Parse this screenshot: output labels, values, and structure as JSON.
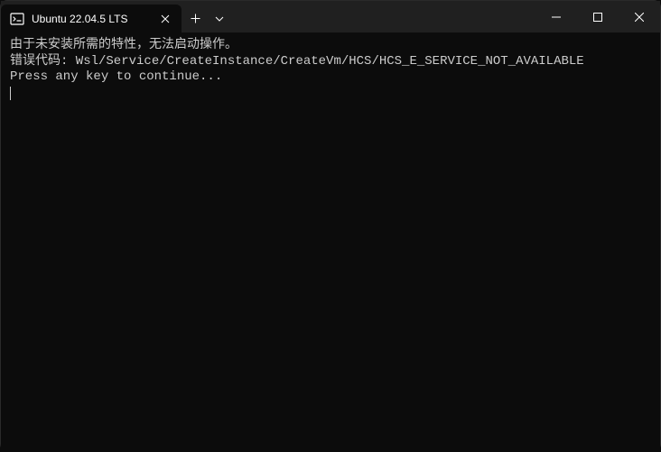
{
  "window": {
    "tab": {
      "title": "Ubuntu 22.04.5 LTS"
    }
  },
  "terminal": {
    "line1": "由于未安装所需的特性，无法启动操作。",
    "line2": "错误代码: Wsl/Service/CreateInstance/CreateVm/HCS/HCS_E_SERVICE_NOT_AVAILABLE",
    "line3": "Press any key to continue..."
  }
}
